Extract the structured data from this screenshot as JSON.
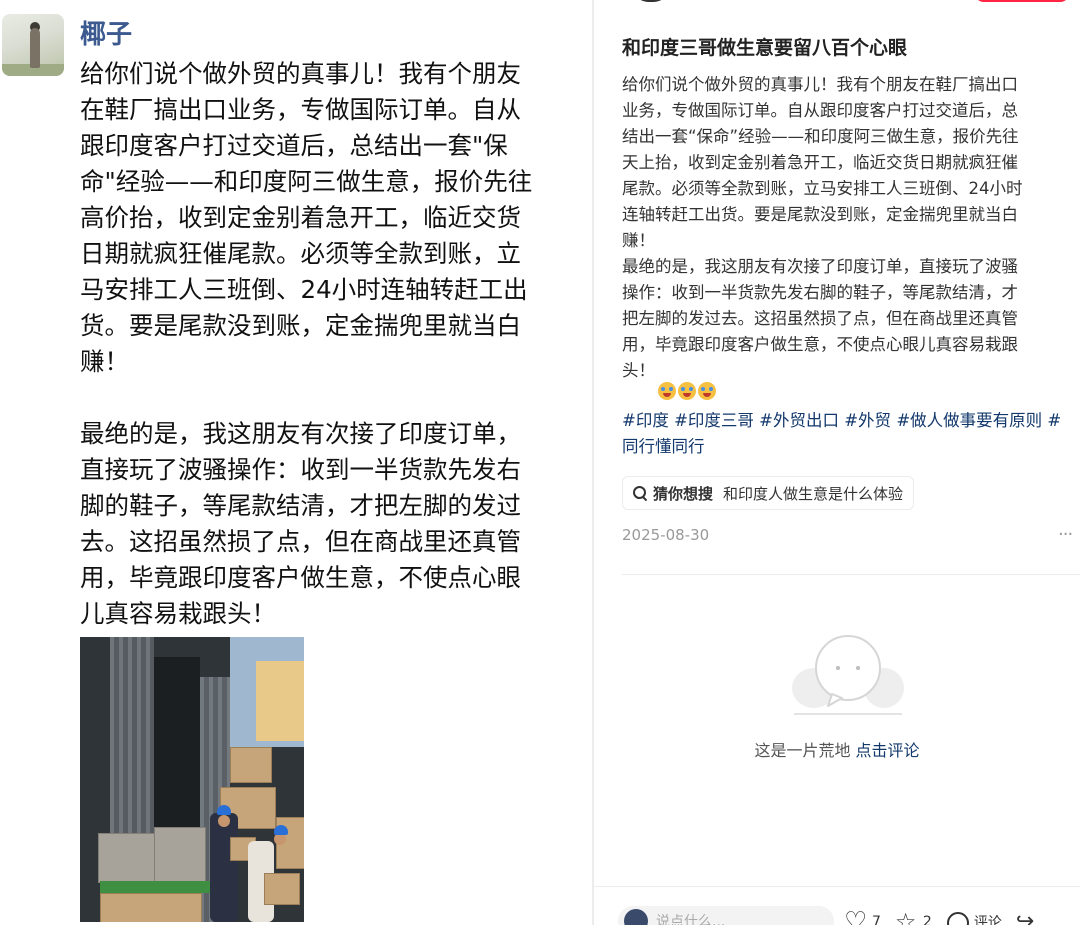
{
  "left_post": {
    "author": "椰子",
    "text": "给你们说个做外贸的真事儿！我有个朋友\n在鞋厂搞出口业务，专做国际订单。自从\n跟印度客户打过交道后，总结出一套\"保\n命\"经验——和印度阿三做生意，报价先往\n高价抬，收到定金别着急开工，临近交货\n日期就疯狂催尾款。必须等全款到账，立\n马安排工人三班倒、24小时连轴转赶工出\n货。要是尾款没到账，定金揣兜里就当白\n赚！\n\n最绝的是，我这朋友有次接了印度订单，\n直接玩了波骚操作：收到一半货款先发右\n脚的鞋子，等尾款结清，才把左脚的发过\n去。这招虽然损了点，但在商战里还真管\n用，毕竟跟印度客户做生意，不使点心眼\n儿真容易栽跟头！"
  },
  "right_panel": {
    "title": "和印度三哥做生意要留八百个心眼",
    "body": "给你们说个做外贸的真事儿！我有个朋友在鞋厂搞出口\n业务，专做国际订单。自从跟印度客户打过交道后，总\n结出一套“保命”经验——和印度阿三做生意，报价先往\n天上抬，收到定金别着急开工，临近交货日期就疯狂催\n尾款。必须等全款到账，立马安排工人三班倒、24小时\n连轴转赶工出货。要是尾款没到账，定金揣兜里就当白\n赚！\n最绝的是，我这朋友有次接了印度订单，直接玩了波骚\n操作：收到一半货款先发右脚的鞋子，等尾款结清，才\n把左脚的发过去。这招虽然损了点，但在商战里还真管\n用，毕竟跟印度客户做生意，不使点心眼儿真容易栽跟\n头！",
    "emoji_icon": "crying-face-emoji",
    "tags": [
      "#印度",
      "#印度三哥",
      "#外贸出口",
      "#外贸",
      "#做人做事要有原则",
      "#同行懂同行"
    ],
    "search_chip": {
      "label": "猜你想搜",
      "query": "和印度人做生意是什么体验"
    },
    "date": "2025-08-30",
    "more": "···",
    "empty_state": {
      "text": "这是一片荒地",
      "cta": "点击评论"
    },
    "bottom_bar": {
      "comment_placeholder": "说点什么...",
      "like_count": "7",
      "collect_count": "2",
      "comment_label": "评论"
    }
  },
  "colors": {
    "author_blue": "#3c5a8f",
    "link_blue": "#13386c",
    "brand_red": "#ff2442",
    "date_grey": "#999999"
  }
}
